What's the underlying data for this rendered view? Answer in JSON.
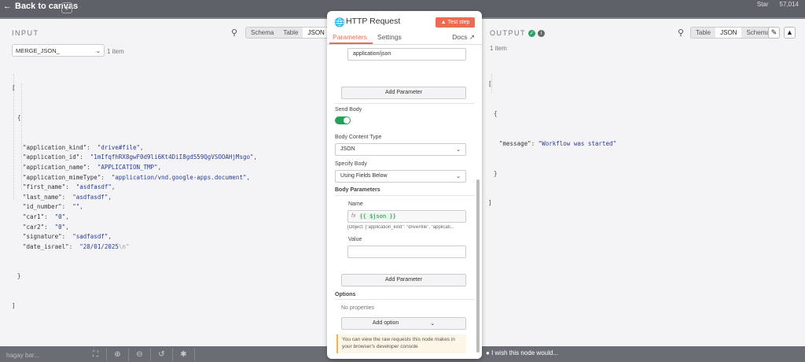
{
  "topbar": {
    "back_label": "Back to canvas",
    "plus": "+",
    "gh_star": "Star",
    "gh_count": "57,014"
  },
  "input": {
    "title": "INPUT",
    "tabs": [
      "Schema",
      "Table",
      "JSON"
    ],
    "active_tab": "JSON",
    "node_select": "MERGE_JSON_",
    "item_count": "1 item",
    "json_items": [
      {
        "key": "\"application_kind\"",
        "value": "\"drive#file\""
      },
      {
        "key": "\"application_id\"",
        "value": "\"1mIfqfhRX8gwF0d9li6Kt4DiI8gd559QgVSOOAHjMsgo\""
      },
      {
        "key": "\"application_name\"",
        "value": "\"APPLICATION_TMP\""
      },
      {
        "key": "\"application_mimeType\"",
        "value": "\"application/vnd.google-apps.document\""
      },
      {
        "key": "\"first_name\"",
        "value": "\"asdfasdf\""
      },
      {
        "key": "\"last_name\"",
        "value": "\"asdfasdf\""
      },
      {
        "key": "\"id_number\"",
        "value": "\"\""
      },
      {
        "key": "\"car1\"",
        "value": "\"0\""
      },
      {
        "key": "\"car2\"",
        "value": "\"0\""
      },
      {
        "key": "\"signature\"",
        "value": "\"sadfasdf\""
      },
      {
        "key": "\"date_israel\"",
        "value": "\"28/01/2025",
        "esc": "\\n\""
      }
    ]
  },
  "modal": {
    "title": "HTTP Request",
    "test_step": "Test step",
    "tab_parameters": "Parameters",
    "tab_settings": "Settings",
    "tab_docs": "Docs",
    "content_type_value": "application/json",
    "add_parameter": "Add Parameter",
    "send_body_label": "Send Body",
    "body_content_type_label": "Body Content Type",
    "body_content_type_value": "JSON",
    "specify_body_label": "Specify Body",
    "specify_body_value": "Using Fields Below",
    "body_parameters_label": "Body Parameters",
    "name_label": "Name",
    "fx": "fx",
    "name_expression": "{{ $json }}",
    "name_preview": "[Object: {\"application_kind\": \"drive#file\", \"applicati...",
    "value_label": "Value",
    "add_parameter_2": "Add Parameter",
    "options_label": "Options",
    "no_properties": "No properties",
    "add_option": "Add option",
    "notice": "You can view the raw requests this node makes in your browser's developer console"
  },
  "output": {
    "title": "OUTPUT",
    "tabs": [
      "Table",
      "JSON",
      "Schema"
    ],
    "active_tab": "JSON",
    "item_count": "1 item",
    "json_key": "\"message\"",
    "json_value": "\"Workflow was started\""
  },
  "bottombar": {
    "user": "hagay bar...",
    "wish": "I wish this node would..."
  },
  "colors": {
    "accent": "#ee6b52",
    "success": "#1ea357",
    "link": "#2a55c8"
  }
}
